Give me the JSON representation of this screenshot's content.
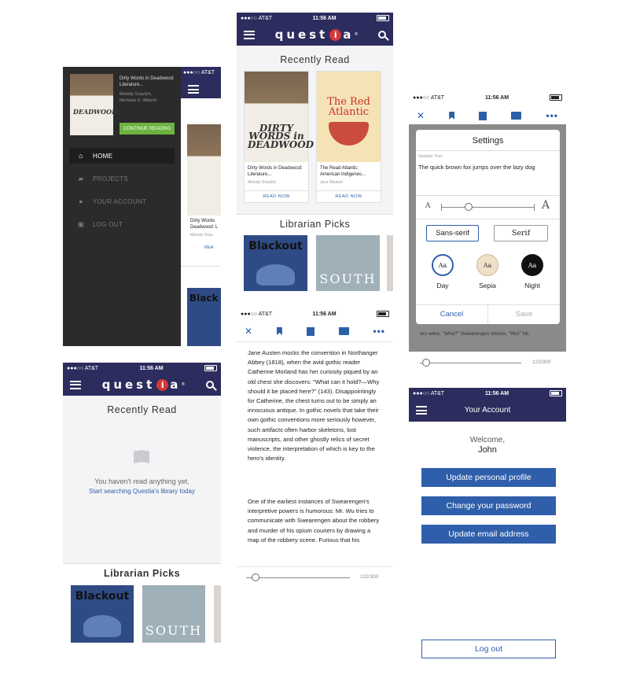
{
  "status_bar": {
    "carrier": "●●●○○ AT&T",
    "time": "11:56 AM"
  },
  "brand": {
    "logo_text_left": "quest",
    "logo_i": "i",
    "logo_text_right": "a",
    "logo_reg": "®"
  },
  "menu_screen": {
    "book_title": "Dirty Words in Deadwood: Literature...",
    "book_authors_1": "Melody Graulich,",
    "book_authors_2": "Nicholas S. Witschi",
    "continue_label": "CONTINUE READING",
    "items": [
      {
        "label": "HOME",
        "icon": "home-icon"
      },
      {
        "label": "PROJECTS",
        "icon": "folder-icon"
      },
      {
        "label": "YOUR ACCOUNT",
        "icon": "person-icon"
      },
      {
        "label": "LOG OUT",
        "icon": "lock-icon"
      }
    ],
    "peek_title": "Dirty Words",
    "peek_sub": "Deadwood: L",
    "peek_author": "Melody Grau",
    "peek_read": "REA",
    "peek_blackout": "Black"
  },
  "home_screen": {
    "recently_read": "Recently Read",
    "books": [
      {
        "title": "Dirty Words in Deadwood: Literature...",
        "author": "Melody Graulich",
        "action": "READ NOW",
        "cover_text": "DIRTY WORDS in DEADWOOD"
      },
      {
        "title": "The Read Atlantic: American Indigenes...",
        "author": "Jace Weaver",
        "action": "READ NOW",
        "cover_text": "The Red Atlantic"
      }
    ],
    "librarian_picks": "Librarian Picks",
    "picks": [
      {
        "cover_text": "Blackout"
      },
      {
        "cover_text": "SOUTH"
      }
    ]
  },
  "empty_screen": {
    "recently_read": "Recently Read",
    "empty_msg": "You haven't read anything yet.",
    "empty_link": "Start searching Questia's library today",
    "librarian_picks": "Librarian Picks",
    "picks": [
      {
        "cover_text": "Blackout"
      },
      {
        "cover_text": "SOUTH"
      }
    ]
  },
  "reader_screen": {
    "close": "✕",
    "more": "•••",
    "para1": "Jane Austen mocks the convention in Northanger Abbey (1818), when the avid gothic reader Catherine Morland has her curiosity piqued by an old chest she discovers: \"What can it hold?—Why should it be placed here?\" (143). Disappointingly for Catherine, the chest turns out to be simply an innocuous antique. In gothic novels that take their own gothic conventions more seriously however, such artifacts often harbor skeletons, lost manuscripts, and other ghostly relics of secret violence, the interpretation of which is key to the hero's identity.",
    "para2": "One of the earliest instances of Swearengen's interpretive powers is humorous: Mr. Wu tries to communicate with Swearengen about the robbery and murder of his opium couriers by drawing a map of the robbery scene. Furious that his",
    "page": "122/300",
    "page_progress": 0.05
  },
  "settings_screen": {
    "title": "Settings",
    "sample_label": "Sample Text",
    "sample_text": "The quick brown fox jumps over the lazy dog",
    "size_small": "A",
    "size_large": "A",
    "size_level": 0.3,
    "font_sans": "Sans-serif",
    "font_serif": "Serif",
    "themes": [
      {
        "name": "Day",
        "glyph": "Aa"
      },
      {
        "name": "Sepia",
        "glyph": "Aa"
      },
      {
        "name": "Night",
        "glyph": "Aa"
      }
    ],
    "cancel": "Cancel",
    "save": "Save",
    "behind_text_1": "ers were, \"Who?\" Swearengen shouts. \"Wu!\" Mr.",
    "page": "122/300",
    "close": "✕",
    "more": "•••"
  },
  "account_screen": {
    "title": "Your Account",
    "welcome": "Welcome,",
    "name": "John",
    "buttons": [
      "Update personal profile",
      "Change your password",
      "Update email address"
    ],
    "logout": "Log out"
  },
  "colors": {
    "navy": "#2c2c5e",
    "blue": "#2f5faa",
    "green": "#6cb33f",
    "dark_menu": "#2b2b2b"
  }
}
